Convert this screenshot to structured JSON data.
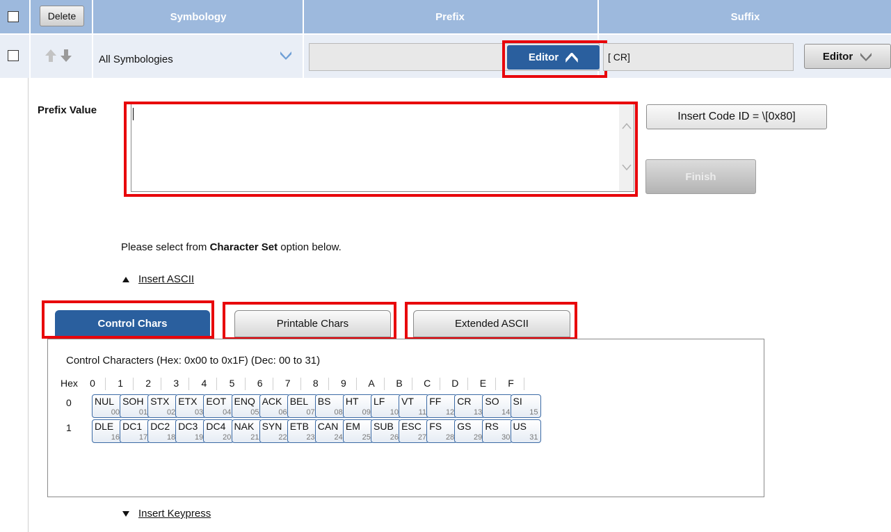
{
  "header": {
    "delete_label": "Delete",
    "symbology_label": "Symbology",
    "prefix_label": "Prefix",
    "suffix_label": "Suffix"
  },
  "row": {
    "symbology_value": "All Symbologies",
    "prefix_value": "",
    "prefix_editor_label": "Editor",
    "suffix_value": "[ CR]",
    "suffix_editor_label": "Editor"
  },
  "editor": {
    "prefix_value_label": "Prefix Value",
    "textarea_value": "",
    "insert_code_label": "Insert Code ID = \\[0x80]",
    "finish_label": "Finish",
    "instruction_pre": "Please select from ",
    "instruction_bold": "Character Set",
    "instruction_post": " option below.",
    "insert_ascii_label": "Insert ASCII",
    "insert_keypress_label": "Insert Keypress"
  },
  "tabs": [
    {
      "label": "Control Chars",
      "active": true
    },
    {
      "label": "Printable Chars",
      "active": false
    },
    {
      "label": "Extended ASCII",
      "active": false
    }
  ],
  "panel": {
    "caption": "Control Characters (Hex: 0x00 to 0x1F) (Dec: 00 to 31)",
    "hex_label": "Hex",
    "columns": [
      "0",
      "1",
      "2",
      "3",
      "4",
      "5",
      "6",
      "7",
      "8",
      "9",
      "A",
      "B",
      "C",
      "D",
      "E",
      "F"
    ],
    "rows": [
      {
        "label": "0",
        "keys": [
          {
            "name": "NUL",
            "dec": "00"
          },
          {
            "name": "SOH",
            "dec": "01"
          },
          {
            "name": "STX",
            "dec": "02"
          },
          {
            "name": "ETX",
            "dec": "03"
          },
          {
            "name": "EOT",
            "dec": "04"
          },
          {
            "name": "ENQ",
            "dec": "05"
          },
          {
            "name": "ACK",
            "dec": "06"
          },
          {
            "name": "BEL",
            "dec": "07"
          },
          {
            "name": "BS",
            "dec": "08"
          },
          {
            "name": "HT",
            "dec": "09"
          },
          {
            "name": "LF",
            "dec": "10"
          },
          {
            "name": "VT",
            "dec": "11"
          },
          {
            "name": "FF",
            "dec": "12"
          },
          {
            "name": "CR",
            "dec": "13"
          },
          {
            "name": "SO",
            "dec": "14"
          },
          {
            "name": "SI",
            "dec": "15"
          }
        ]
      },
      {
        "label": "1",
        "keys": [
          {
            "name": "DLE",
            "dec": "16"
          },
          {
            "name": "DC1",
            "dec": "17"
          },
          {
            "name": "DC2",
            "dec": "18"
          },
          {
            "name": "DC3",
            "dec": "19"
          },
          {
            "name": "DC4",
            "dec": "20"
          },
          {
            "name": "NAK",
            "dec": "21"
          },
          {
            "name": "SYN",
            "dec": "22"
          },
          {
            "name": "ETB",
            "dec": "23"
          },
          {
            "name": "CAN",
            "dec": "24"
          },
          {
            "name": "EM",
            "dec": "25"
          },
          {
            "name": "SUB",
            "dec": "26"
          },
          {
            "name": "ESC",
            "dec": "27"
          },
          {
            "name": "FS",
            "dec": "28"
          },
          {
            "name": "GS",
            "dec": "29"
          },
          {
            "name": "RS",
            "dec": "30"
          },
          {
            "name": "US",
            "dec": "31"
          }
        ]
      }
    ]
  },
  "colors": {
    "header_bg": "#9db9dd",
    "accent_blue": "#2a5f9e",
    "highlight_red": "#e8050b"
  }
}
